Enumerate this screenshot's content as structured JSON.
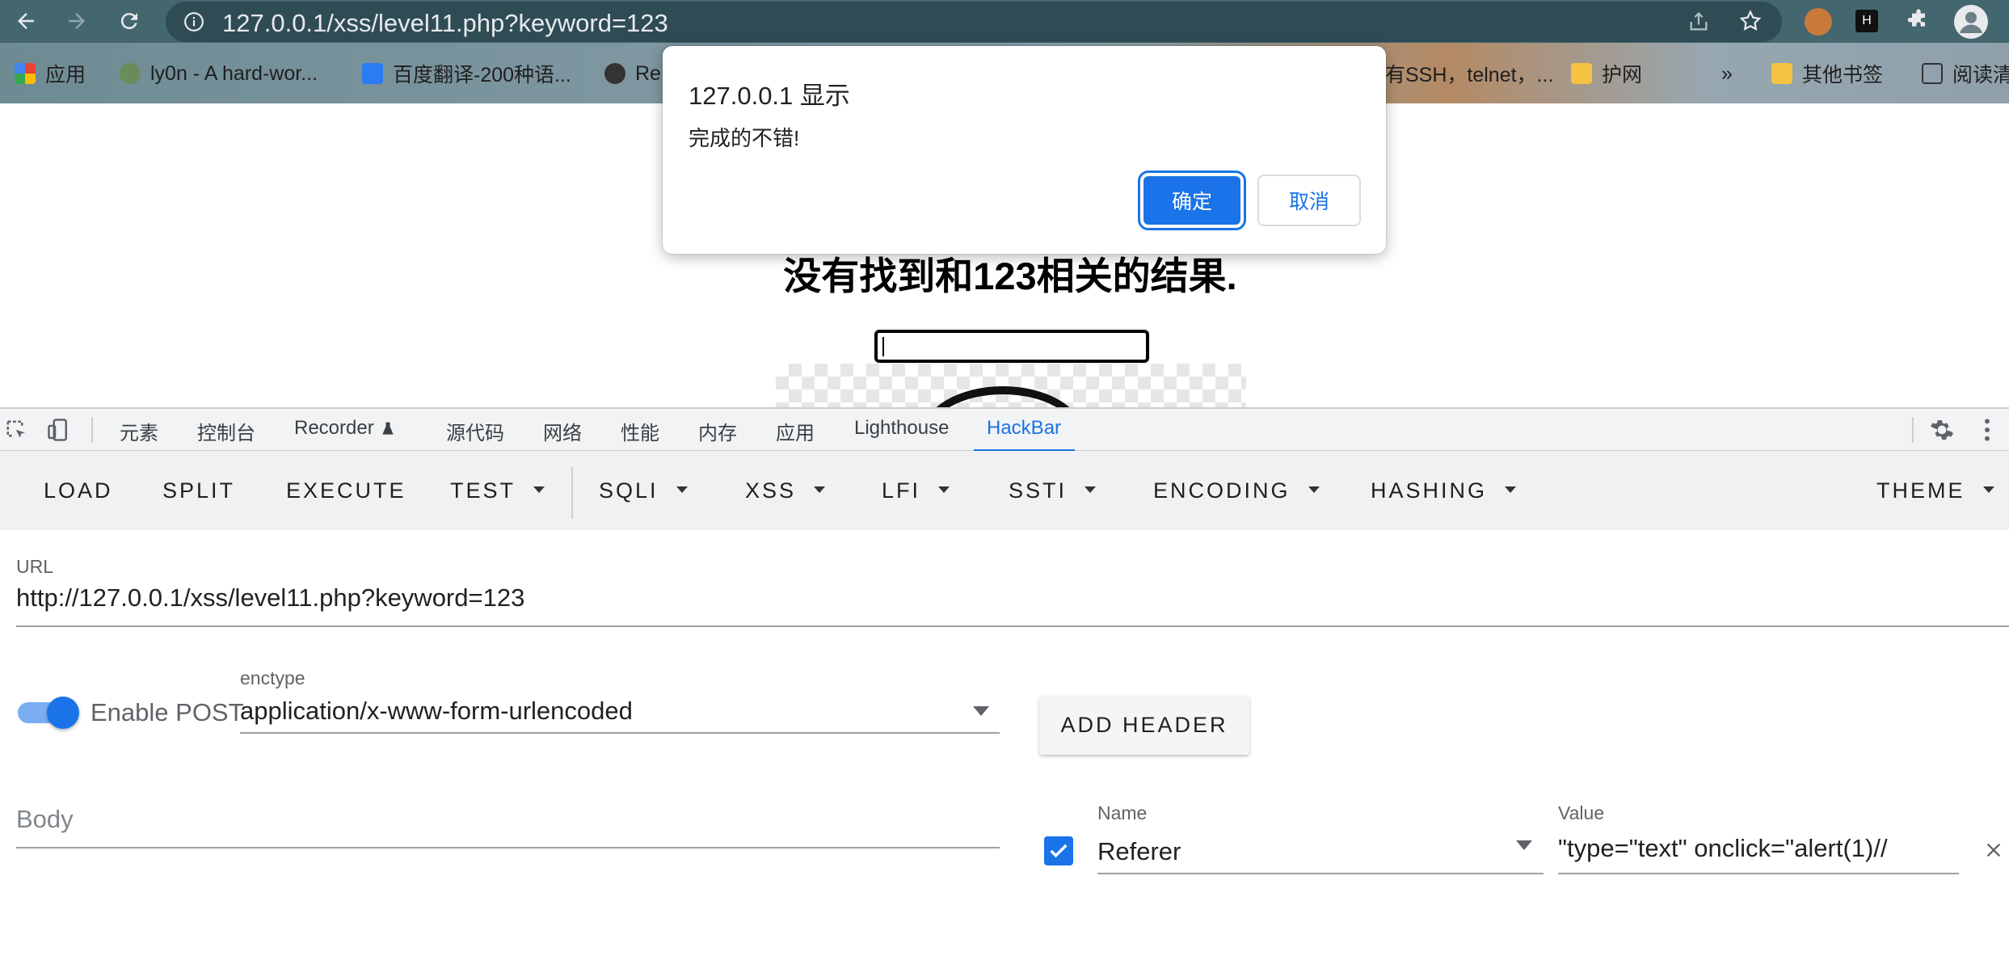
{
  "browser": {
    "url": "127.0.0.1/xss/level11.php?keyword=123",
    "bookmarks": [
      "应用",
      "ly0n - A hard-wor...",
      "百度翻译-200种语...",
      "Re",
      "有SSH，telnet，...",
      "护网",
      "»",
      "其他书签",
      "阅读清"
    ]
  },
  "page": {
    "result_title": "没有找到和123相关的结果."
  },
  "dialog": {
    "title": "127.0.0.1 显示",
    "message": "完成的不错!",
    "ok_label": "确定",
    "cancel_label": "取消"
  },
  "devtools": {
    "tabs": [
      "元素",
      "控制台",
      "Recorder",
      "源代码",
      "网络",
      "性能",
      "内存",
      "应用",
      "Lighthouse",
      "HackBar"
    ],
    "active_tab": "HackBar"
  },
  "hackbar": {
    "toolbar": {
      "load": "LOAD",
      "split": "SPLIT",
      "execute": "EXECUTE",
      "test": "TEST",
      "sqli": "SQLI",
      "xss": "XSS",
      "lfi": "LFI",
      "ssti": "SSTI",
      "encoding": "ENCODING",
      "hashing": "HASHING",
      "theme": "THEME"
    },
    "url_label": "URL",
    "url_value": "http://127.0.0.1/xss/level11.php?keyword=123",
    "enable_post_label": "Enable POST",
    "enable_post": true,
    "enctype_label": "enctype",
    "enctype_value": "application/x-www-form-urlencoded",
    "add_header_label": "ADD HEADER",
    "body_placeholder": "Body",
    "header": {
      "enabled": true,
      "name_label": "Name",
      "name_value": "Referer",
      "value_label": "Value",
      "value_value": "\"type=\"text\" onclick=\"alert(1)//"
    }
  },
  "colors": {
    "accent": "#1a73e8",
    "topbar": "#44676f"
  }
}
